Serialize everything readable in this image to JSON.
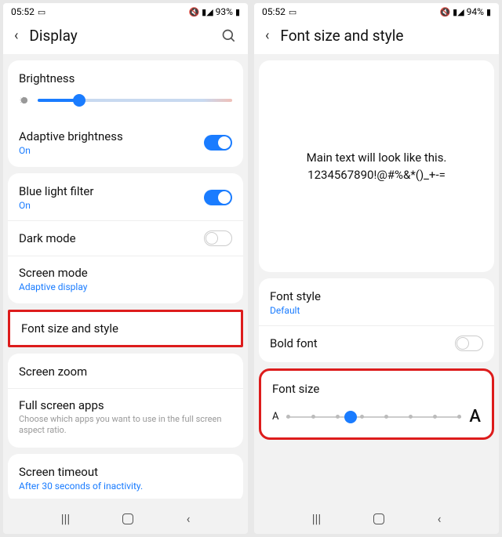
{
  "left": {
    "status": {
      "time": "05:52",
      "battery": "93%"
    },
    "header": {
      "title": "Display"
    },
    "brightness": {
      "label": "Brightness"
    },
    "adaptive": {
      "label": "Adaptive brightness",
      "sub": "On"
    },
    "bluelight": {
      "label": "Blue light filter",
      "sub": "On"
    },
    "darkmode": {
      "label": "Dark mode"
    },
    "screenmode": {
      "label": "Screen mode",
      "sub": "Adaptive display"
    },
    "fontsize": {
      "label": "Font size and style"
    },
    "screenzoom": {
      "label": "Screen zoom"
    },
    "fullscreen": {
      "label": "Full screen apps",
      "hint": "Choose which apps you want to use in the full screen aspect ratio."
    },
    "timeout": {
      "label": "Screen timeout",
      "sub": "After 30 seconds of inactivity."
    }
  },
  "right": {
    "status": {
      "time": "05:52",
      "battery": "94%"
    },
    "header": {
      "title": "Font size and style"
    },
    "preview": {
      "line1": "Main text will look like this.",
      "line2": "1234567890!@#%&*()_+-="
    },
    "fontstyle": {
      "label": "Font style",
      "sub": "Default"
    },
    "boldfont": {
      "label": "Bold font"
    },
    "fontsize": {
      "label": "Font size",
      "small": "A",
      "big": "A"
    }
  }
}
